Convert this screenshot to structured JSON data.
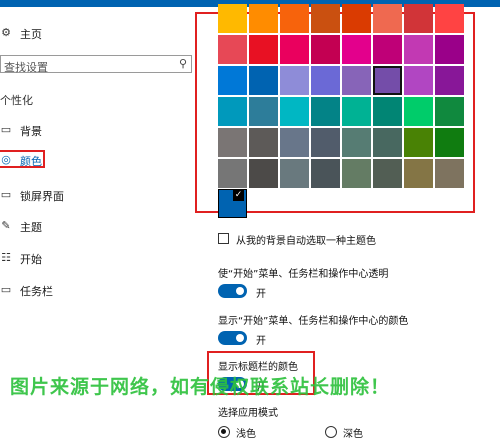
{
  "sidebar": {
    "home_label": "主页",
    "search_placeholder": "查找设置",
    "section_title": "个性化",
    "items": [
      {
        "label": "背景",
        "icon": "picture-icon"
      },
      {
        "label": "颜色",
        "icon": "palette-icon",
        "selected": true
      },
      {
        "label": "锁屏界面",
        "icon": "monitor-icon"
      },
      {
        "label": "主题",
        "icon": "brush-icon"
      },
      {
        "label": "开始",
        "icon": "start-grid-icon"
      },
      {
        "label": "任务栏",
        "icon": "taskbar-icon"
      }
    ]
  },
  "colors": {
    "accent": "#0063b1",
    "highlight_frame": "#e02020",
    "selected_swatch_row": 2,
    "selected_swatch_col": 5,
    "rows": [
      [
        "#ffb900",
        "#ff8c00",
        "#f7630c",
        "#ca5010",
        "#da3b01",
        "#ef6950",
        "#d13438",
        "#ff4343"
      ],
      [
        "#e74856",
        "#e81123",
        "#ea005e",
        "#c30052",
        "#e3008c",
        "#bf0077",
        "#c239b3",
        "#9a0089"
      ],
      [
        "#0078d7",
        "#0063b1",
        "#8e8cd8",
        "#6b69d6",
        "#8764b8",
        "#744da9",
        "#b146c2",
        "#881798"
      ],
      [
        "#0099bc",
        "#2d7d9a",
        "#00b7c3",
        "#038387",
        "#00b294",
        "#018574",
        "#00cc6a",
        "#10893e"
      ],
      [
        "#7a7574",
        "#5d5a58",
        "#68768a",
        "#515c6b",
        "#567c73",
        "#486860",
        "#498205",
        "#107c10"
      ],
      [
        "#767676",
        "#4c4a48",
        "#69797e",
        "#4a5459",
        "#647c64",
        "#525e54",
        "#847545",
        "#7e735f"
      ]
    ]
  },
  "settings": {
    "auto_pick_label": "从我的背景自动选取一种主题色",
    "transparency_label": "使“开始”菜单、任务栏和操作中心透明",
    "transparency_state": "开",
    "start_color_label": "显示“开始”菜单、任务栏和操作中心的颜色",
    "start_color_state": "开",
    "titlebar_color_label": "显示标题栏的颜色",
    "titlebar_color_state": "开",
    "app_mode_label": "选择应用模式",
    "mode_light": "浅色",
    "mode_dark": "深色",
    "mode_selected": "浅色"
  },
  "watermark": "图片来源于网络，如有侵权联系站长删除！"
}
